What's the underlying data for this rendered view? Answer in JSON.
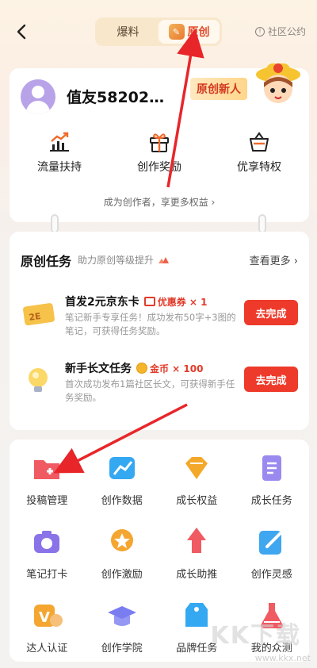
{
  "nav": {
    "tabs": [
      {
        "label": "爆料"
      },
      {
        "label": "原创",
        "active": true
      }
    ],
    "rules_label": "社区公约"
  },
  "profile": {
    "username": "值友58202…",
    "promo_text": "原创新人",
    "perks": [
      {
        "label": "流量扶持",
        "icon": "trend-chart-icon"
      },
      {
        "label": "创作奖励",
        "icon": "gift-box-icon"
      },
      {
        "label": "优享特权",
        "icon": "basket-icon"
      }
    ],
    "more_perks": "成为创作者，享更多权益 ›"
  },
  "tasks": {
    "title": "原创任务",
    "subtitle": "助力原创等级提升",
    "more": "查看更多 ›",
    "items": [
      {
        "title": "首发2元京东卡",
        "reward": "优惠券 × 1",
        "desc": "笔记新手专享任务！成功发布50字+3图的笔记，可获得任务奖励。",
        "button": "去完成",
        "icon": "jd-card-icon"
      },
      {
        "title": "新手长文任务",
        "reward": "金币 × 100",
        "desc": "首次成功发布1篇社区长文，可获得新手任务奖励。",
        "button": "去完成",
        "icon": "lightbulb-icon"
      }
    ]
  },
  "tools": [
    {
      "label": "投稿管理",
      "icon": "folder-plus-icon",
      "color": "#f05a63"
    },
    {
      "label": "创作数据",
      "icon": "data-chart-icon",
      "color": "#35a8f2"
    },
    {
      "label": "成长权益",
      "icon": "diamond-crown-icon",
      "color": "#f4a82a"
    },
    {
      "label": "成长任务",
      "icon": "task-list-icon",
      "color": "#9a8af0"
    },
    {
      "label": "笔记打卡",
      "icon": "camera-icon",
      "color": "#8a73e8"
    },
    {
      "label": "创作激励",
      "icon": "star-medal-icon",
      "color": "#f4a630"
    },
    {
      "label": "成长助推",
      "icon": "rocket-up-icon",
      "color": "#f05a63"
    },
    {
      "label": "创作灵感",
      "icon": "pencil-note-icon",
      "color": "#3fa6f0"
    },
    {
      "label": "达人认证",
      "icon": "v-badge-icon",
      "color": "#f4a630"
    },
    {
      "label": "创作学院",
      "icon": "graduation-cap-icon",
      "color": "#7a7df0"
    },
    {
      "label": "品牌任务",
      "icon": "shopping-tag-icon",
      "color": "#35a8f2"
    },
    {
      "label": "我的众测",
      "icon": "flask-icon",
      "color": "#f05a63"
    }
  ],
  "watermark": "www.kkx.net",
  "watermark_logo": "KK下载"
}
